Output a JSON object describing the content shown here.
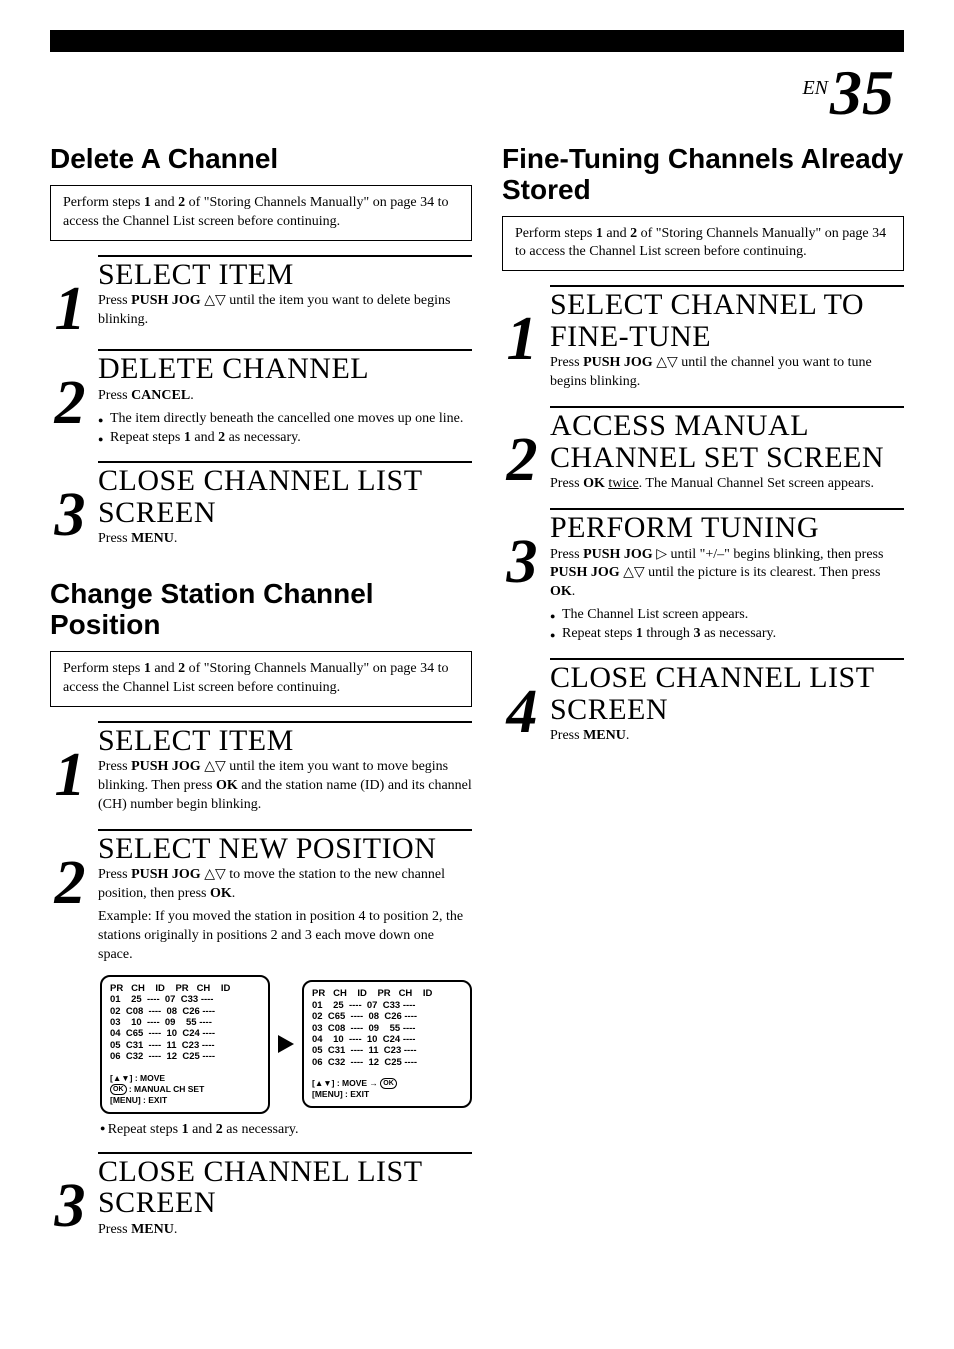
{
  "page": {
    "prefix": "EN",
    "number": "35"
  },
  "intro": {
    "pre": "Perform steps ",
    "s1": "1",
    "mid1": " and ",
    "s2": "2",
    "post": " of \"Storing Channels Manually\" on page 34 to access the Channel List screen before continuing."
  },
  "left": {
    "delete": {
      "title": "Delete A Channel",
      "step1": {
        "num": "1",
        "title": "SELECT ITEM",
        "t1": "Press ",
        "t2": "PUSH JOG",
        "t3": " △▽ until the item you want to delete begins blinking."
      },
      "step2": {
        "num": "2",
        "title": "DELETE CHANNEL",
        "t1": "Press ",
        "t2": "CANCEL",
        "t3": ".",
        "b1": "The item directly beneath the cancelled one moves up one line.",
        "b2a": "Repeat steps ",
        "b2b": "1",
        "b2c": " and ",
        "b2d": "2",
        "b2e": " as necessary."
      },
      "step3": {
        "num": "3",
        "title": "CLOSE CHANNEL LIST SCREEN",
        "t1": "Press ",
        "t2": "MENU",
        "t3": "."
      }
    },
    "change": {
      "title": "Change Station Channel Position",
      "step1": {
        "num": "1",
        "title": "SELECT ITEM",
        "t1": "Press ",
        "t2": "PUSH JOG",
        "t3": " △▽ until the item you want to move begins blinking. Then press ",
        "t4": "OK",
        "t5": " and the station name (ID) and its channel (CH) number begin blinking."
      },
      "step2": {
        "num": "2",
        "title": "SELECT NEW POSITION",
        "t1": "Press ",
        "t2": "PUSH JOG",
        "t3": " △▽ to move the station to the new channel position, then press ",
        "t4": "OK",
        "t5": ".",
        "ex": "Example: If you moved the station in position 4 to position 2, the stations originally in positions 2 and 3 each move down one space.",
        "repeat_a": "Repeat steps ",
        "repeat_b": "1",
        "repeat_c": " and ",
        "repeat_d": "2",
        "repeat_e": " as necessary."
      },
      "step3": {
        "num": "3",
        "title": "CLOSE CHANNEL LIST SCREEN",
        "t1": "Press ",
        "t2": "MENU",
        "t3": "."
      }
    }
  },
  "right": {
    "fine": {
      "title": "Fine-Tuning Channels Already Stored",
      "step1": {
        "num": "1",
        "title": "SELECT CHANNEL TO FINE-TUNE",
        "t1": "Press ",
        "t2": "PUSH JOG",
        "t3": " △▽ until the channel you want to tune begins blinking."
      },
      "step2": {
        "num": "2",
        "title": "ACCESS MANUAL CHANNEL SET SCREEN",
        "t1": "Press ",
        "t2": "OK",
        "t3": " ",
        "t4": "twice",
        "t5": ". The Manual Channel Set screen appears."
      },
      "step3": {
        "num": "3",
        "title": "PERFORM TUNING",
        "t1": "Press ",
        "t2": "PUSH JOG",
        "t3": " ▷ until \"+/–\" begins blinking, then press ",
        "t4": "PUSH JOG",
        "t5": " △▽ until the picture is its clearest. Then press ",
        "t6": "OK",
        "t7": ".",
        "b1": "The Channel List screen appears.",
        "b2a": "Repeat steps ",
        "b2b": "1",
        "b2c": " through ",
        "b2d": "3",
        "b2e": " as necessary."
      },
      "step4": {
        "num": "4",
        "title": "CLOSE CHANNEL LIST SCREEN",
        "t1": "Press ",
        "t2": "MENU",
        "t3": "."
      }
    }
  },
  "tv": {
    "before": {
      "hdr": "PR   CH    ID    PR   CH    ID",
      "l1": "01    25  ----  07  C33 ----",
      "l2": "02  C08  ----  08  C26 ----",
      "l3": "03    10  ----  09    55 ----",
      "l4": "04  C65  ----  10  C24 ----",
      "l5": "05  C31  ----  11  C23 ----",
      "l6": "06  C32  ----  12  C25 ----",
      "f1": "[▲▼] : MOVE",
      "f2": " : MANUAL CH SET",
      "f3": "[MENU] : EXIT",
      "ok": "OK"
    },
    "after": {
      "hdr": "PR   CH    ID    PR   CH    ID",
      "l1": "01    25  ----  07  C33 ----",
      "l2": "02  C65  ----  08  C26 ----",
      "l3": "03  C08  ----  09    55 ----",
      "l4": "04    10  ----  10  C24 ----",
      "l5": "05  C31  ----  11  C23 ----",
      "l6": "06  C32  ----  12  C25 ----",
      "f1": "[▲▼] : MOVE → ",
      "f2": "[MENU] : EXIT",
      "ok": "OK"
    }
  }
}
